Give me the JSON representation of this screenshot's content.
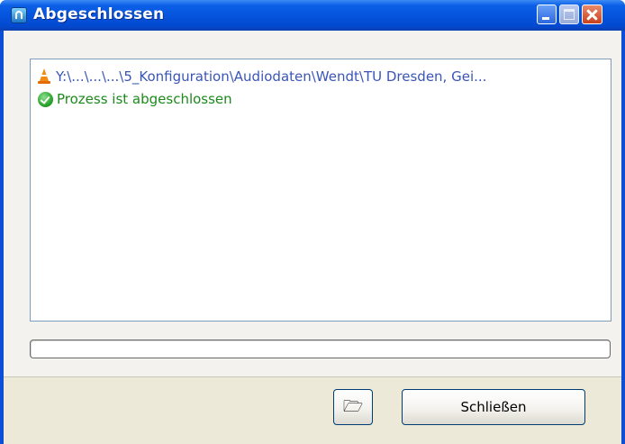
{
  "window": {
    "title": "Abgeschlossen",
    "icon": "app-headphone-icon",
    "controls": [
      "minimize-icon",
      "maximize-icon",
      "close-icon"
    ]
  },
  "log": {
    "lines": [
      {
        "icon": "vlc-cone-icon",
        "text": "Y:\\...\\...\\...\\5_Konfiguration\\Audiodaten\\Wendt\\TU Dresden, Gei..."
      },
      {
        "icon": "success-check-icon",
        "text": "Prozess ist abgeschlossen"
      }
    ]
  },
  "progress": {
    "value": 0
  },
  "buttons": {
    "open_folder": {
      "icon": "open-folder-icon",
      "glyph": "🗁"
    },
    "close": {
      "label": "Schließen"
    }
  },
  "colors": {
    "titlebar": "#0655de",
    "path_text": "#3a55b8",
    "success_text": "#1c8a1c",
    "dialog_bg": "#ece9d8"
  }
}
